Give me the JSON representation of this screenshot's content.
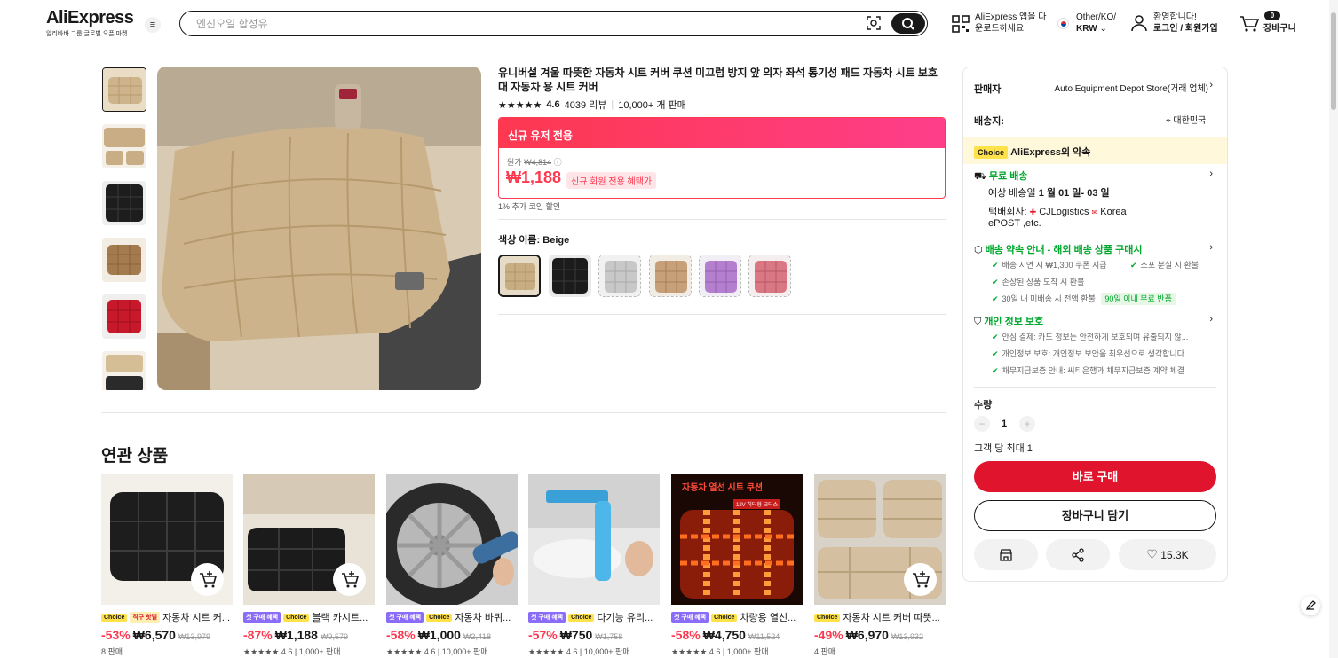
{
  "header": {
    "logo": "AliExpress",
    "logo_tagline": "알리바바 그룹 글로벌 오픈 마켓",
    "search_placeholder": "엔진오일 합성유",
    "app_download": [
      "AliExpress 앱을 다",
      "운로드하세요"
    ],
    "locale_top": "Other/KO/",
    "locale_currency": "KRW",
    "welcome": "환영합니다!",
    "login": "로그인 / 회원가입",
    "cart_count": "0",
    "cart_label": "장바구니"
  },
  "product": {
    "title": "유니버설 겨울 따뜻한 자동차 시트 커버 쿠션 미끄럼 방지 앞 의자 좌석 통기성 패드 자동차 시트 보호대 자동차 용 시트 커버",
    "rating": "4.6",
    "reviews": "4039 리뷰",
    "sold": "10,000+ 개 판매",
    "promo_header": "신규 유저 전용",
    "orig_label": "원가",
    "orig_price": "₩4,814",
    "price": "₩1,188",
    "price_tag": "신규 회원 전용 혜택가",
    "coin_note": "1% 추가 코인 할인",
    "color_label": "색상 이름: Beige",
    "swatches": [
      "beige",
      "black",
      "gray",
      "tan",
      "purple",
      "pink"
    ]
  },
  "panel": {
    "seller_label": "판매자",
    "seller_name": "Auto Equipment Depot Store(거래 업체)",
    "ship_label": "배송지:",
    "ship_to": "대한민국",
    "choice_tag": "Choice",
    "promise": "AliExpress의 약속",
    "free_ship": "무료 배송",
    "delivery_prefix": "예상 배송일",
    "delivery_date": "1 월 01 일- 03 일",
    "courier_label": "택배회사:",
    "courier_1": "CJLogistics",
    "courier_2": "Korea",
    "courier_3": "ePOST ,etc.",
    "assure_title": "배송 약속 안내 - 해외 배송 상품 구매시",
    "assure_1": "배송 지연 시 ₩1,300 쿠폰 지급",
    "assure_2": "소포 분실 시 환불",
    "assure_3": "손상된 상품 도착 시 환불",
    "assure_4": "30일 내 미배송 시 전액 환불",
    "assure_badge": "90일 이내 무료 반품",
    "privacy_title": "개인 정보 보호",
    "privacy_1": "안심 결제: 카드 정보는 안전하게 보호되며 유출되지 않...",
    "privacy_2": "개인정보 보호: 개인정보 보안을 최우선으로 생각합니다.",
    "privacy_3": "채무지급보증 안내: 씨티은행과 채무지급보증 계약 체결",
    "qty_label": "수량",
    "qty": "1",
    "qty_limit": "고객 당 최대 1",
    "buy_now": "바로 구매",
    "add_cart": "장바구니 담기",
    "wish_count": "15.3K"
  },
  "related": {
    "title": "연관 상품",
    "items": [
      {
        "tag1": "Choice",
        "tag2": "직구 핫딜",
        "name": "자동차 시트 커...",
        "disc": "-53%",
        "price": "₩6,570",
        "old": "₩13,979",
        "meta": "8 판매"
      },
      {
        "tag1": "첫 구매 혜택",
        "tag2": "Choice",
        "name": "블랙 카시트...",
        "disc": "-87%",
        "price": "₩1,188",
        "old": "₩9,579",
        "meta": "4.6 | 1,000+ 판매"
      },
      {
        "tag1": "첫 구매 혜택",
        "tag2": "Choice",
        "name": "자동차 바퀴...",
        "disc": "-58%",
        "price": "₩1,000",
        "old": "₩2,418",
        "meta": "4.6 | 10,000+ 판매"
      },
      {
        "tag1": "첫 구매 혜택",
        "tag2": "Choice",
        "name": "다기능 유리...",
        "disc": "-57%",
        "price": "₩750",
        "old": "₩1,758",
        "meta": "4.6 | 10,000+ 판매"
      },
      {
        "tag1": "첫 구매 혜택",
        "tag2": "Choice",
        "name": "차량용 열선...",
        "disc": "-58%",
        "price": "₩4,750",
        "old": "₩11,524",
        "meta": "4.6 | 1,000+ 판매"
      },
      {
        "tag1": "Choice",
        "tag2": "",
        "name": "자동차 시트 커버 따뜻...",
        "disc": "-49%",
        "price": "₩6,970",
        "old": "₩13,932",
        "meta": "4 판매"
      }
    ],
    "heater_banner": "자동차 열선 시트 쿠션",
    "heater_sub": "12V 히터형 모터스"
  }
}
